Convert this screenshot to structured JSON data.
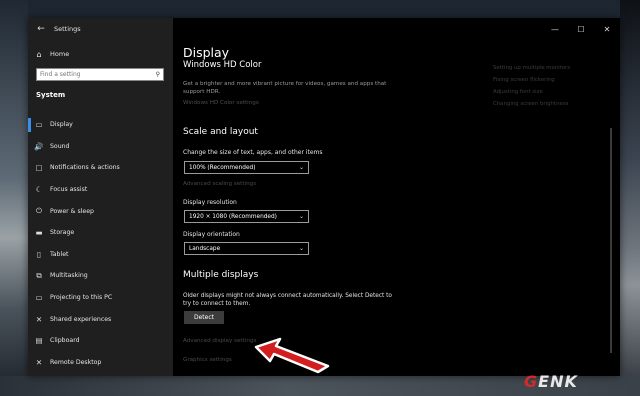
{
  "window": {
    "title": "Settings",
    "controls": {
      "minimize": "—",
      "maximize": "☐",
      "close": "✕"
    }
  },
  "sidebar": {
    "back_icon": "←",
    "home_label": "Home",
    "search_placeholder": "Find a setting",
    "section_heading": "System",
    "items": [
      {
        "label": "Display",
        "icon": "▭"
      },
      {
        "label": "Sound",
        "icon": "🔊"
      },
      {
        "label": "Notifications & actions",
        "icon": "▢"
      },
      {
        "label": "Focus assist",
        "icon": "☾"
      },
      {
        "label": "Power & sleep",
        "icon": "⏻"
      },
      {
        "label": "Storage",
        "icon": "▬"
      },
      {
        "label": "Tablet",
        "icon": "▯"
      },
      {
        "label": "Multitasking",
        "icon": "⧉"
      },
      {
        "label": "Projecting to this PC",
        "icon": "▭"
      },
      {
        "label": "Shared experiences",
        "icon": "✕"
      },
      {
        "label": "Clipboard",
        "icon": "▤"
      },
      {
        "label": "Remote Desktop",
        "icon": "✕"
      }
    ]
  },
  "main": {
    "page_title": "Display",
    "hdr": {
      "title": "Windows HD Color",
      "description": "Get a brighter and more vibrant picture for videos, games and apps that support HDR.",
      "link": "Windows HD Color settings"
    },
    "scale_layout": {
      "heading": "Scale and layout",
      "scale_label": "Change the size of text, apps, and other items",
      "scale_value": "100% (Recommended)",
      "advanced_link": "Advanced scaling settings",
      "resolution_label": "Display resolution",
      "resolution_value": "1920 × 1080 (Recommended)",
      "orientation_label": "Display orientation",
      "orientation_value": "Landscape"
    },
    "multiple_displays": {
      "heading": "Multiple displays",
      "description": "Older displays might not always connect automatically. Select Detect to try to connect to them.",
      "detect_label": "Detect",
      "advanced_link": "Advanced display settings",
      "graphics_link": "Graphics settings"
    },
    "related": [
      "Setting up multiple monitors",
      "Fixing screen flickering",
      "Adjusting font size",
      "Changing screen brightness"
    ]
  },
  "watermark": {
    "text_a": "G",
    "text_b": "ENK"
  }
}
